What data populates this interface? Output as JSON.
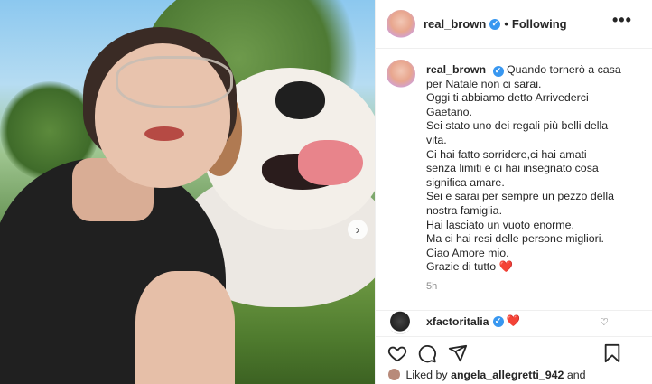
{
  "post": {
    "author": {
      "username": "real_brown",
      "verified_glyph": "✓",
      "separator": "•",
      "follow_status": "Following",
      "more_glyph": "•••"
    },
    "caption": {
      "username": "real_brown",
      "lines": [
        "Quando tornerò a casa",
        "per Natale non ci sarai.",
        "Oggi ti abbiamo detto Arrivederci",
        "Gaetano.",
        "Sei stato uno dei regali più belli della",
        "vita.",
        "Ci hai fatto sorridere,ci hai amati",
        "senza limiti e ci hai insegnato cosa",
        "significa amare.",
        "Sei e sarai per sempre un pezzo della",
        "nostra famiglia.",
        "Hai lasciato un vuoto enorme.",
        "Ma ci hai resi delle persone migliori.",
        "Ciao Amore mio.",
        "Grazie di tutto"
      ],
      "end_emoji": "❤️",
      "time": "5h"
    },
    "comment": {
      "username": "xfactoritalia",
      "emoji": "❤️",
      "like_glyph": "♡"
    },
    "liked_by": {
      "prefix": "Liked by",
      "user": "angela_allegretti_942",
      "suffix": "and"
    },
    "carousel_next_glyph": "›",
    "icons": [
      "heart-icon",
      "comment-icon",
      "share-icon",
      "bookmark-icon"
    ],
    "colors": {
      "verified": "#3897f0",
      "heart": "#e0245e",
      "meta": "#8e8e8e"
    }
  }
}
